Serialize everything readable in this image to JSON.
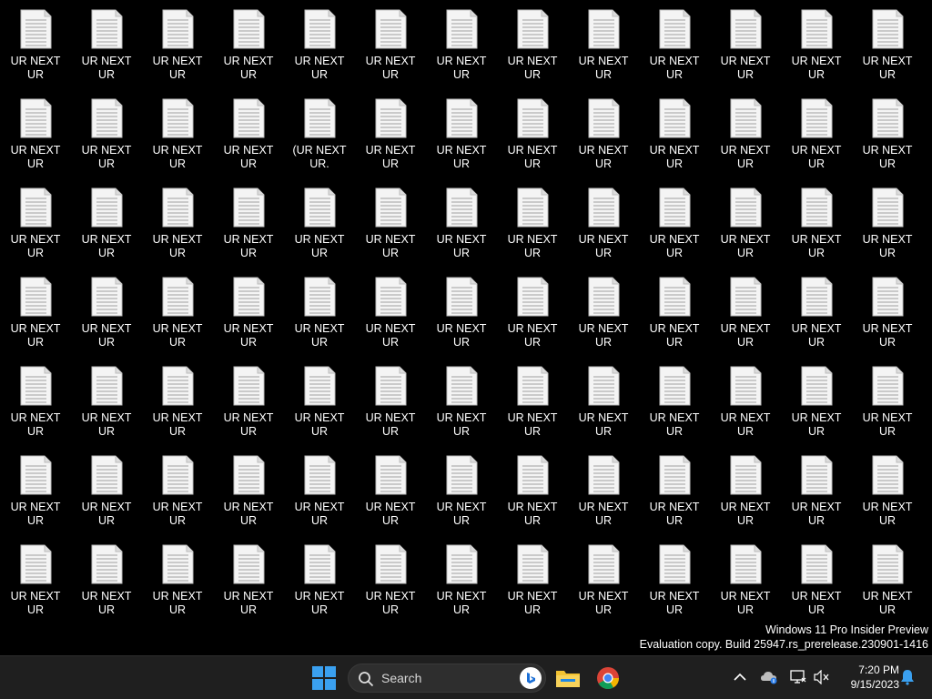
{
  "desktop": {
    "file_label": "UR NEXT UR\nNEXT UR ...",
    "special_labels": {
      "0": "UR NEXT UR\nNEXT UR ...",
      "17": "(UR NEXT UR.\nNEXT UR ...",
      "67": "UR NEXT UR\nNEXT UR x.",
      "76": "UR NEXT UR\nNEXT UR ..."
    },
    "item_count": 91
  },
  "watermark": {
    "line1": "Windows 11 Pro Insider Preview",
    "line2": "Evaluation copy. Build 25947.rs_prerelease.230901-1416"
  },
  "taskbar": {
    "search_placeholder": "Search",
    "clock_time": "7:20 PM",
    "clock_date": "9/15/2023"
  },
  "colors": {
    "taskbar_bg": "#1f1f1f",
    "start_blue": "#3aa0f0",
    "folder_yellow": "#f2c231"
  }
}
